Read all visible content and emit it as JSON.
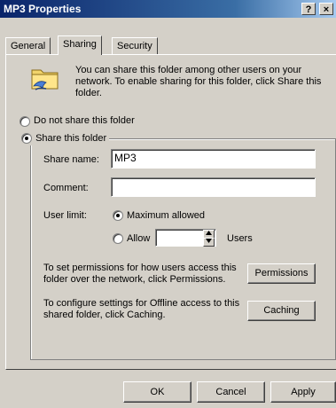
{
  "window": {
    "title": "MP3 Properties",
    "help_label": "?",
    "close_label": "×"
  },
  "tabs": [
    {
      "label": "General"
    },
    {
      "label": "Sharing"
    },
    {
      "label": "Security"
    }
  ],
  "info": {
    "text": "You can share this folder among other users on your network.  To enable sharing for this folder, click Share this folder."
  },
  "sharing": {
    "do_not_share_label": "Do not share this folder",
    "share_label": "Share this folder",
    "selected": "share"
  },
  "fields": {
    "share_name_label": "Share name:",
    "share_name_value": "MP3",
    "comment_label": "Comment:",
    "comment_value": "",
    "user_limit_label": "User limit:",
    "maximum_allowed_label": "Maximum allowed",
    "allow_label": "Allow",
    "allow_value": "",
    "users_label": "Users",
    "user_limit_selected": "maximum"
  },
  "permissions": {
    "text": "To set permissions for how users access this folder over the network, click Permissions.",
    "button_label": "Permissions"
  },
  "caching": {
    "text": "To configure settings for Offline access to this shared folder, click Caching.",
    "button_label": "Caching"
  },
  "footer": {
    "ok_label": "OK",
    "cancel_label": "Cancel",
    "apply_label": "Apply"
  }
}
